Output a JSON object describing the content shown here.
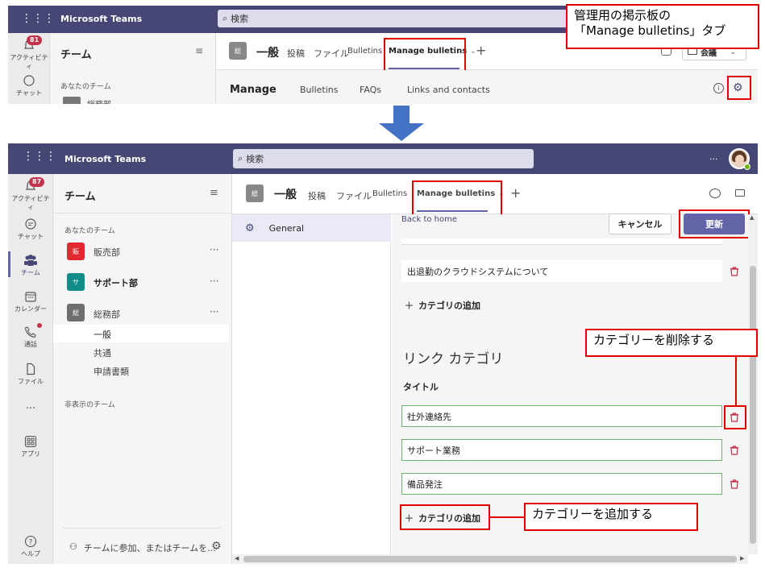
{
  "top": {
    "app_title": "Microsoft Teams",
    "search_placeholder": "検索",
    "activity_badge": "81",
    "activity_label": "アクティビティ",
    "chat_label": "チャット",
    "teams_header": "チーム",
    "your_teams": "あなたのチーム",
    "team_partial": "総務部",
    "channel_abbr": "総",
    "channel_name": "一般",
    "tabs": [
      "投稿",
      "ファイル",
      "Bulletins",
      "Manage bulletins"
    ],
    "meet_label": "会議",
    "sub_tabs": [
      "Manage",
      "Bulletins",
      "FAQs",
      "Links and contacts"
    ],
    "callout": "管理用の掲示板の\n「Manage bulletins」タブ"
  },
  "bottom": {
    "app_title": "Microsoft Teams",
    "search_placeholder": "検索",
    "more": "···",
    "rail": [
      {
        "label": "アクティビティ",
        "badge": "87",
        "icon": "bell-icon"
      },
      {
        "label": "チャット",
        "icon": "chat-icon"
      },
      {
        "label": "チーム",
        "icon": "teams-icon"
      },
      {
        "label": "カレンダー",
        "icon": "calendar-icon"
      },
      {
        "label": "通話",
        "icon": "phone-icon"
      },
      {
        "label": "ファイル",
        "icon": "file-icon"
      },
      {
        "label": "···",
        "icon": "more-icon"
      },
      {
        "label": "アプリ",
        "icon": "apps-icon"
      },
      {
        "label": "ヘルプ",
        "icon": "help-icon"
      }
    ],
    "teams_header": "チーム",
    "your_teams": "あなたのチーム",
    "teams": [
      {
        "abbr": "販",
        "name": "販売部",
        "color": "#e3282f"
      },
      {
        "abbr": "サ",
        "name": "サポート部",
        "color": "#108c8a"
      },
      {
        "abbr": "総",
        "name": "総務部",
        "color": "#6e6e6e"
      }
    ],
    "channels": [
      "一般",
      "共通",
      "申請書類"
    ],
    "hidden_teams": "非表示のチーム",
    "join_team": "チームに参加、またはチームを...",
    "channel_abbr": "総",
    "channel_name": "一般",
    "tabs": [
      "投稿",
      "ファイル",
      "Bulletins",
      "Manage bulletins"
    ],
    "settings_nav": "General",
    "back_home": "Back to home",
    "cancel": "キャンセル",
    "update": "更新",
    "row_existing": "出退勤のクラウドシステムについて",
    "add_category_1": "カテゴリの追加",
    "link_category": "リンク カテゴリ",
    "title_label": "タイトル",
    "links": [
      "社外連絡先",
      "サポート業務",
      "備品発注"
    ],
    "add_category_2": "カテゴリの追加",
    "callout_delete": "カテゴリーを削除する",
    "callout_add": "カテゴリーを追加する"
  },
  "colors": {
    "teams_purple": "#464775",
    "accent": "#6264a7",
    "red": "#e00000",
    "trash": "#c4314b"
  }
}
